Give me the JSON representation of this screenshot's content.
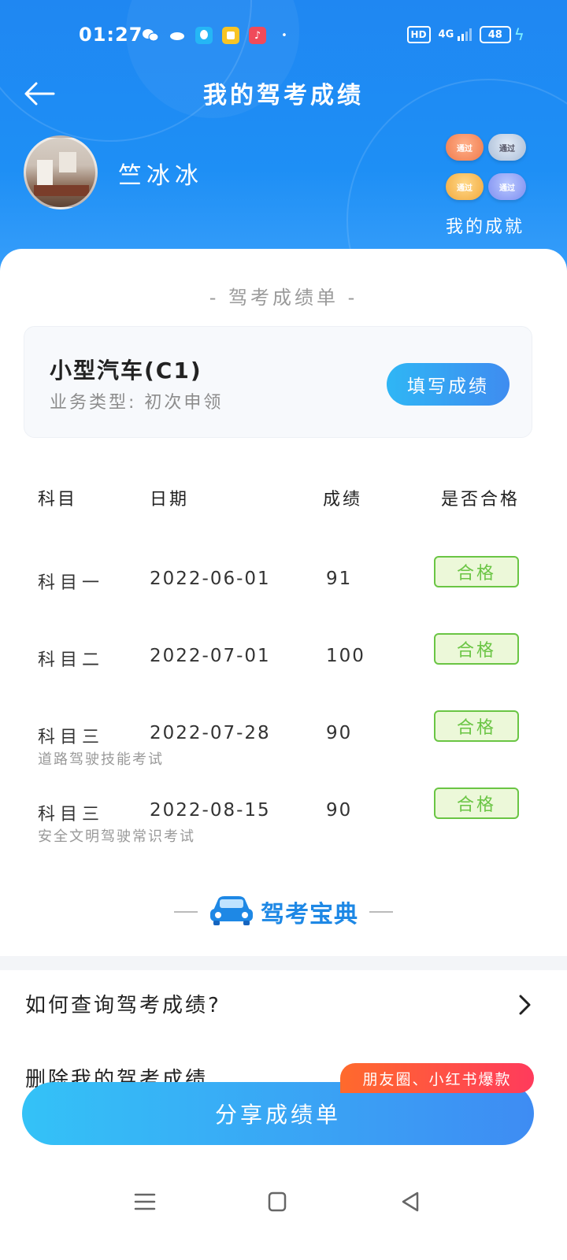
{
  "status_bar": {
    "time": "01:27",
    "hd": "HD",
    "network": "4G",
    "battery": "48"
  },
  "header": {
    "title": "我的驾考成绩",
    "user_name": "竺冰冰",
    "medal_label": "通过",
    "achievements_label": "我的成就"
  },
  "report": {
    "section_title": "- 驾考成绩单 -",
    "license_name": "小型汽车(C1)",
    "business_type": "业务类型: 初次申领",
    "fill_button": "填写成绩"
  },
  "table": {
    "headers": [
      "科目",
      "日期",
      "成绩",
      "是否合格"
    ],
    "rows": [
      {
        "subject": "科目一",
        "note": "",
        "date": "2022-06-01",
        "score": "91",
        "status": "合格"
      },
      {
        "subject": "科目二",
        "note": "",
        "date": "2022-07-01",
        "score": "100",
        "status": "合格"
      },
      {
        "subject": "科目三",
        "note": "道路驾驶技能考试",
        "date": "2022-07-28",
        "score": "90",
        "status": "合格"
      },
      {
        "subject": "科目三",
        "note": "安全文明驾驶常识考试",
        "date": "2022-08-15",
        "score": "90",
        "status": "合格"
      }
    ]
  },
  "brand": {
    "name": "驾考宝典"
  },
  "faq": {
    "item1": "如何查询驾考成绩?",
    "item2": "删除我的驾考成绩"
  },
  "share": {
    "button": "分享成绩单",
    "promo": "朋友圈、小红书爆款"
  },
  "colors": {
    "primary": "#1f87f2",
    "pass_green": "#6ac544",
    "promo_red": "#ff3b5c"
  }
}
